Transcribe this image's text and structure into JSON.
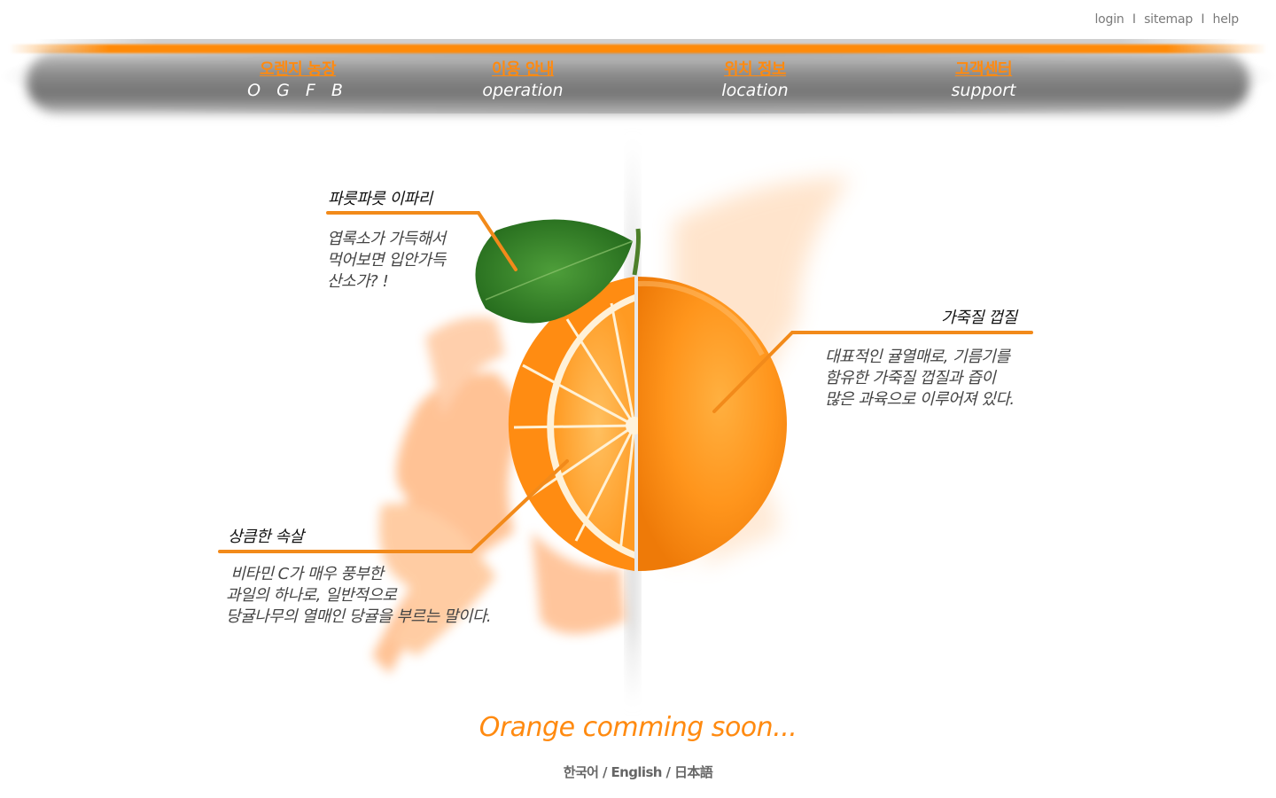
{
  "util_links": {
    "login": "login",
    "sitemap": "sitemap",
    "help": "help",
    "separator": "I"
  },
  "nav": {
    "items": [
      {
        "kr": "오렌지 농장",
        "en": "O G F B"
      },
      {
        "kr": "이용 안내",
        "en": "operation"
      },
      {
        "kr": "위치 정보",
        "en": "location"
      },
      {
        "kr": "고객센터",
        "en": "support"
      }
    ]
  },
  "annotations": {
    "leaf": {
      "title": "파릇파릇 이파리",
      "lines": [
        "엽록소가 가득해서",
        "먹어보면 입안가득",
        "산소가? !"
      ]
    },
    "peel": {
      "title": "가죽질 껍질",
      "lines": [
        "대표적인 귤열매로, 기름기를",
        "함유한 가죽질 껍질과 즙이",
        "많은 과육으로 이루어져 있다."
      ]
    },
    "flesh": {
      "title": "상큼한 속살",
      "lines": [
        " 비타민 C가 매우 풍부한",
        "과일의 하나로, 일반적으로",
        "당귤나무의 열매인 당귤을 부르는 말이다."
      ]
    }
  },
  "footer": {
    "soon": "Orange comming soon...",
    "lang_ko": "한국어",
    "lang_en": "English",
    "lang_ja": "日本語",
    "lang_sep": " / "
  },
  "colors": {
    "accent": "#ff8a10",
    "annotation_line": "#f28a1a"
  },
  "icons": {
    "center_image": "orange-half-cut-illustration",
    "leaf": "leaf-icon"
  }
}
